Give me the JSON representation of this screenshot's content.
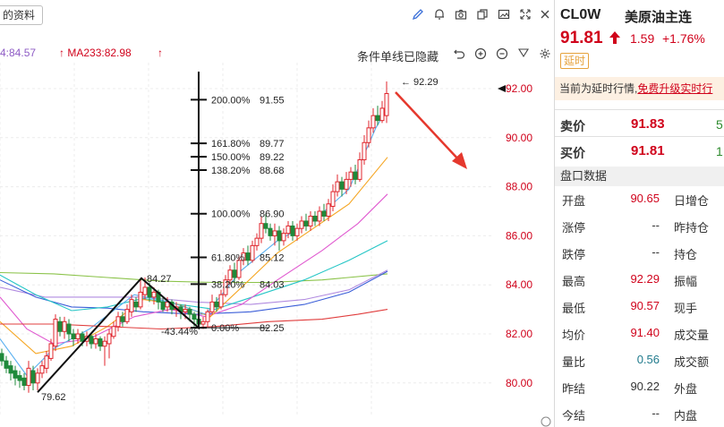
{
  "toolbar": {
    "info_tab_label": "的资料",
    "icons": [
      "pencil-icon",
      "bell-icon",
      "camera-icon",
      "copy-icon",
      "image-icon",
      "expand-icon",
      "close-icon"
    ]
  },
  "ma_bar": {
    "ma5_text": "4:84.57",
    "ma233_text": "MA233:82.98",
    "ma5_color": "#8e5cc5",
    "ma233_color": "#d0021b"
  },
  "toolbar2": {
    "condition_text": "条件单线已隐藏",
    "icons": [
      "undo-icon",
      "zoom-in-icon",
      "zoom-out-icon",
      "gear-icon"
    ]
  },
  "chart_data": {
    "type": "candlestick",
    "y_axis_ticks": [
      "92.00",
      "90.00",
      "88.00",
      "86.00",
      "84.00",
      "82.00",
      "80.00"
    ],
    "ylim": [
      79.2,
      93.1
    ],
    "max_label": "92.29",
    "min_label": "79.62",
    "peak_label": "84.27",
    "trough_pct_label": "-43.44%",
    "fib_levels": [
      {
        "pct": "200.00%",
        "value": "91.55"
      },
      {
        "pct": "161.80%",
        "value": "89.77"
      },
      {
        "pct": "150.00%",
        "value": "89.22"
      },
      {
        "pct": "138.20%",
        "value": "88.68"
      },
      {
        "pct": "100.00%",
        "value": "86.90"
      },
      {
        "pct": "61.80%",
        "value": "85.12"
      },
      {
        "pct": "38.20%",
        "value": "84.03"
      },
      {
        "pct": "0.00%",
        "value": "82.25"
      }
    ],
    "colors": {
      "up": "#e0262d",
      "down": "#1f8a3b",
      "axis_text": "#d0021b",
      "arrow": "#e5382d"
    }
  },
  "quote": {
    "symbol": "CL0W",
    "name": "美原油主连",
    "price": "91.81",
    "change": "1.59",
    "change_pct": "+1.76%",
    "delay_badge": "延时",
    "notice_prefix": "当前为延时行情,",
    "notice_link": "免费升级实时行",
    "ask_label": "卖价",
    "ask_price": "91.83",
    "ask_qty": "5",
    "bid_label": "买价",
    "bid_price": "91.81",
    "bid_qty": "1",
    "section_title": "盘口数据",
    "stats": [
      {
        "label": "开盘",
        "value": "90.65",
        "color": "#d0021b",
        "label2": "日增仓"
      },
      {
        "label": "涨停",
        "value": "--",
        "color": "#333333",
        "label2": "昨持仓"
      },
      {
        "label": "跌停",
        "value": "--",
        "color": "#333333",
        "label2": "持仓"
      },
      {
        "label": "最高",
        "value": "92.29",
        "color": "#d0021b",
        "label2": "振幅"
      },
      {
        "label": "最低",
        "value": "90.57",
        "color": "#d0021b",
        "label2": "现手"
      },
      {
        "label": "均价",
        "value": "91.40",
        "color": "#d0021b",
        "label2": "成交量"
      },
      {
        "label": "量比",
        "value": "0.56",
        "color": "#1f7a8c",
        "label2": "成交额"
      },
      {
        "label": "昨结",
        "value": "90.22",
        "color": "#333333",
        "label2": "外盘"
      },
      {
        "label": "今结",
        "value": "--",
        "color": "#333333",
        "label2": "内盘"
      }
    ]
  }
}
